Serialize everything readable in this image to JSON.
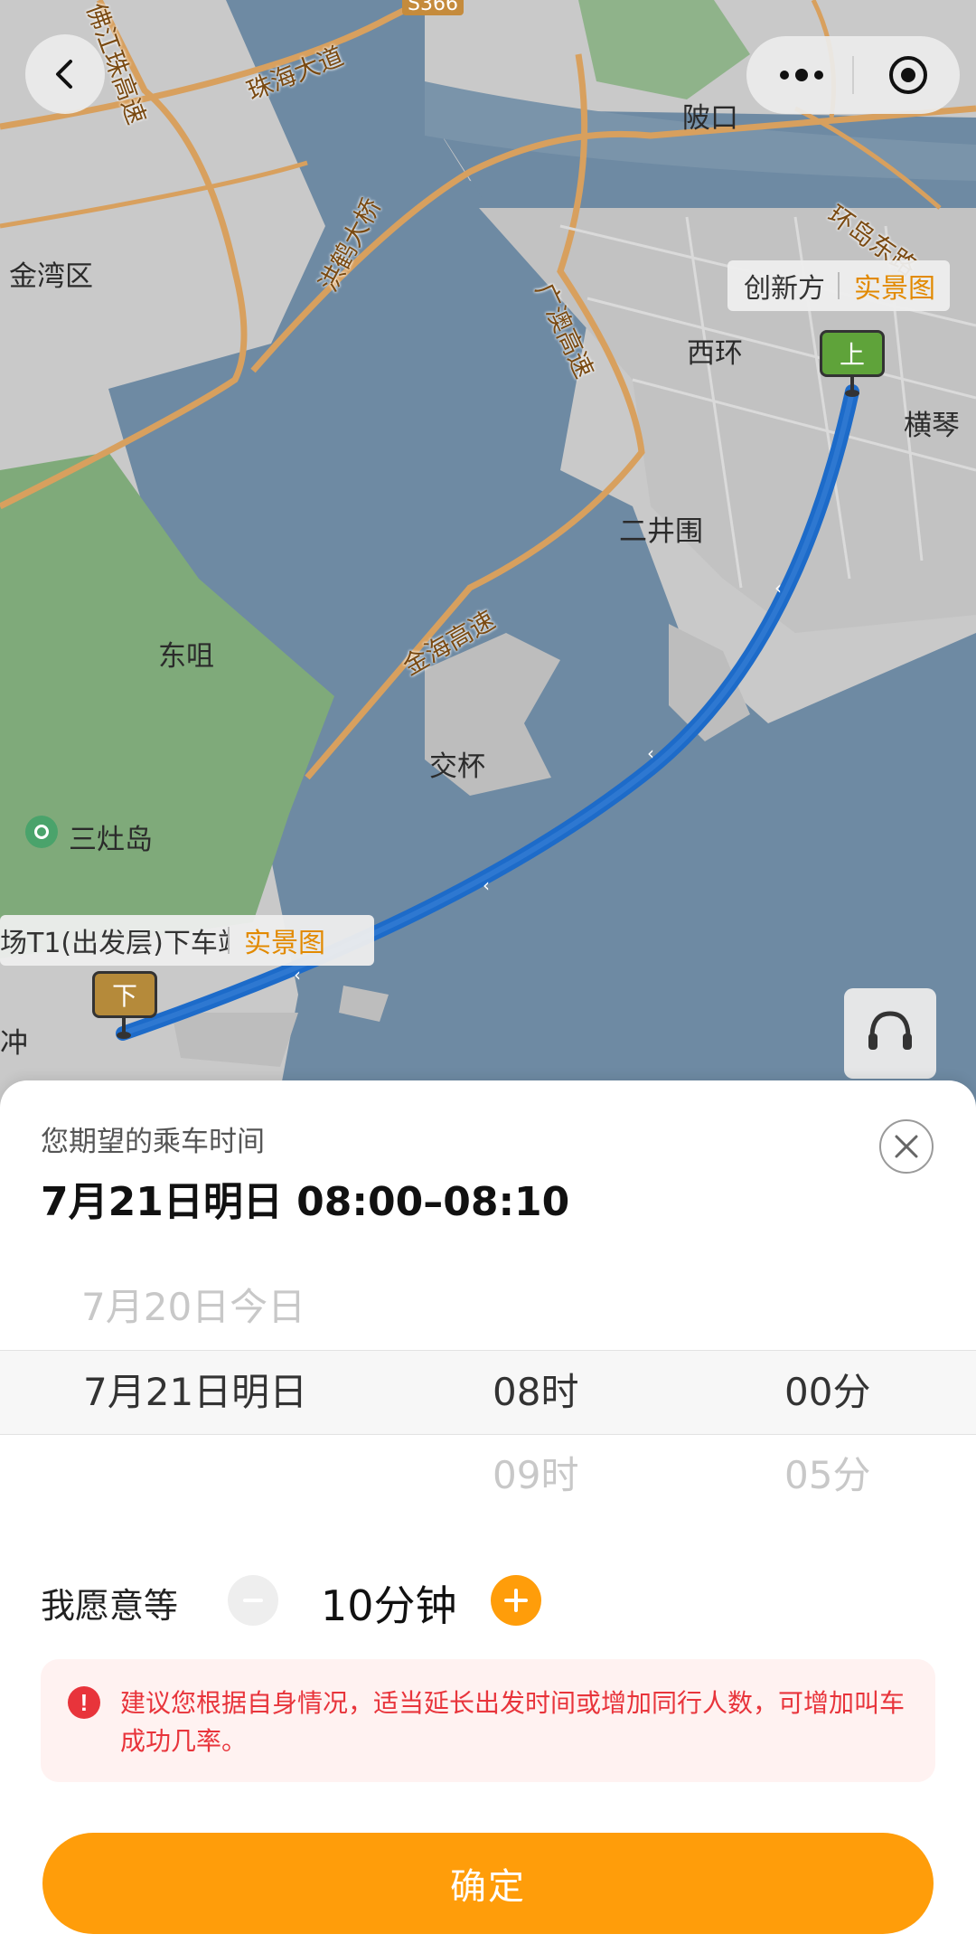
{
  "map": {
    "place_labels": {
      "jinwan": "金湾区",
      "lingkou": "陂口",
      "xihuan": "西环",
      "hengqin": "横琴",
      "erjingwei": "二井围",
      "dongju": "东咀",
      "jiaobei": "交杯",
      "sanzaodao": "三灶岛",
      "chong": "冲"
    },
    "road_labels": {
      "zhuhai_avenue": "珠海大道",
      "honghe_bridge": "洪鹤大桥",
      "fogang_highway": "佛江珠高速",
      "jingang_highway": "金海高速",
      "gangao_highway": "广澳高速",
      "huandao": "环岛东路",
      "s366": "S366"
    },
    "pickup_marker": "上",
    "dropoff_marker": "下",
    "pickup_tag": {
      "name": "创新方",
      "action": "实景图"
    },
    "dropoff_tag": {
      "name": "场T1(出发层)下车站",
      "action": "实景图"
    }
  },
  "sheet": {
    "title": "您期望的乘车时间",
    "selected_time": "7月21日明日  08:00–08:10",
    "picker": {
      "prev_row": {
        "date": "7月20日今日"
      },
      "selected_row": {
        "date": "7月21日明日",
        "hour": "08时",
        "minute": "00分"
      },
      "next_row": {
        "hour": "09时",
        "minute": "05分"
      }
    },
    "wait": {
      "label": "我愿意等",
      "value": "10分钟"
    },
    "warning": "建议您根据自身情况，适当延长出发时间或增加同行人数，可增加叫车成功几率。",
    "confirm": "确定"
  },
  "colors": {
    "accent": "#ff9d0a",
    "route": "#1d6bc9",
    "warning": "#e8343b",
    "water": "#6e8aa3",
    "land": "#c9c9c9",
    "green": "#7faa7a"
  }
}
